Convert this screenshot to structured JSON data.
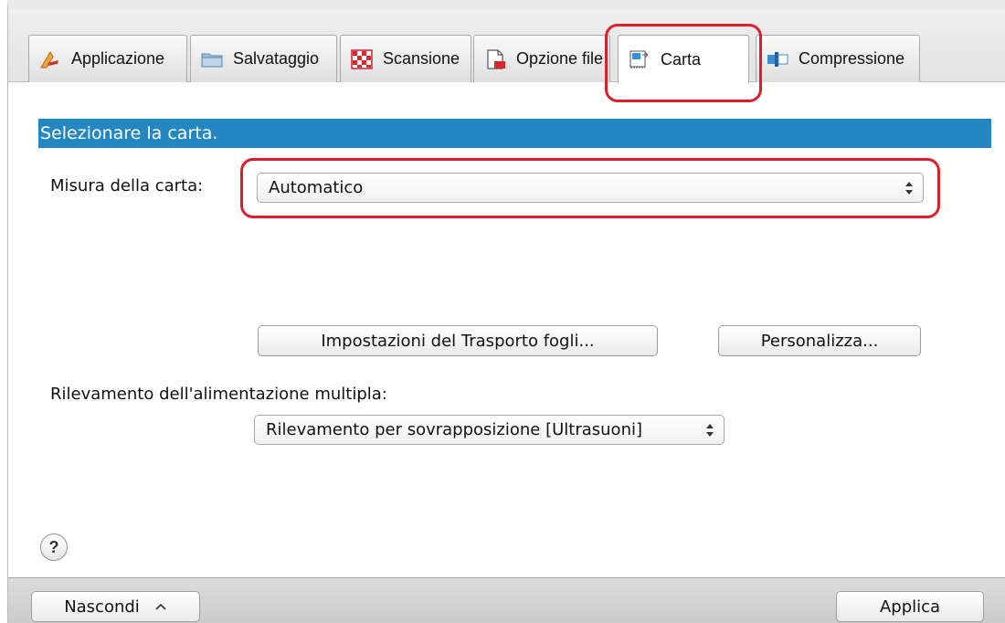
{
  "tabs": [
    {
      "label": "Applicazione",
      "icon": "application-icon"
    },
    {
      "label": "Salvataggio",
      "icon": "folder-icon"
    },
    {
      "label": "Scansione",
      "icon": "scan-icon"
    },
    {
      "label": "Opzione file",
      "icon": "file-option-icon"
    },
    {
      "label": "Carta",
      "icon": "paper-icon",
      "active": true
    },
    {
      "label": "Compressione",
      "icon": "compression-icon"
    }
  ],
  "section": {
    "title": "Selezionare la carta."
  },
  "paper_size": {
    "label": "Misura della carta:",
    "value": "Automatico"
  },
  "buttons": {
    "feeder_settings": "Impostazioni del Trasporto fogli...",
    "customize": "Personalizza..."
  },
  "multifeed": {
    "label": "Rilevamento dell'alimentazione multipla:",
    "value": "Rilevamento per sovrapposizione [Ultrasuoni]"
  },
  "help": {
    "symbol": "?"
  },
  "footer": {
    "hide_label": "Nascondi",
    "hide_icon": "chevron-up-icon",
    "apply_label": "Applica"
  },
  "colors": {
    "accent": "#2487c1",
    "highlight": "#d9202c"
  }
}
